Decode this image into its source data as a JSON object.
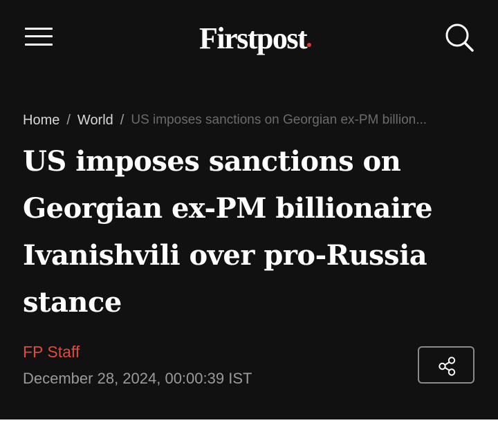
{
  "header": {
    "logo_text": "Firstpost",
    "menu_icon": "hamburger-menu-icon",
    "search_icon": "search-icon",
    "logo_dot_color": "#e23a2d"
  },
  "breadcrumb": {
    "items": [
      "Home",
      "World"
    ],
    "separator": "/",
    "current": "US imposes sanctions on Georgian ex-PM billion..."
  },
  "article": {
    "headline": "US imposes sanctions on Georgian ex-PM billionaire Ivanishvili over pro-Russia stance",
    "author": "FP Staff",
    "date": "December 28, 2024, 00:00:39 IST",
    "share_icon": "share-icon"
  },
  "colors": {
    "background": "#111111",
    "accent": "#e2493e",
    "text": "#ffffff",
    "muted": "#9a9a9a"
  }
}
